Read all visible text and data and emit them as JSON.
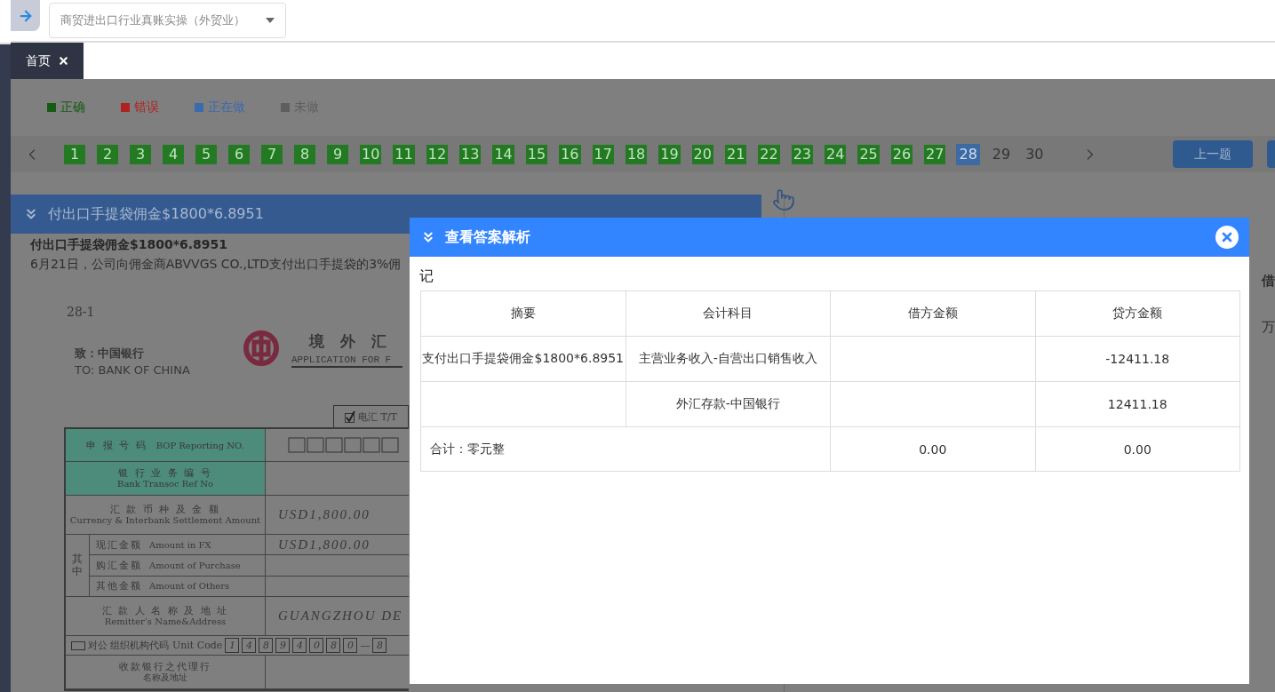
{
  "top_bar": {
    "course_select": {
      "value": "商贸进出口行业真账实操（外贸业）"
    }
  },
  "tabs": [
    {
      "label": "首页",
      "selected": true
    }
  ],
  "legend": [
    {
      "label": "正确",
      "color": "#145c14"
    },
    {
      "label": "错误",
      "color": "#b02222"
    },
    {
      "label": "正在做",
      "color": "#3a6ab0"
    },
    {
      "label": "未做",
      "color": "#5e5e5e"
    }
  ],
  "question_nav": {
    "items": [
      {
        "label": "1",
        "correct": true,
        "selected": false
      },
      {
        "label": "2",
        "correct": true,
        "selected": false
      },
      {
        "label": "3",
        "correct": true,
        "selected": false
      },
      {
        "label": "4",
        "correct": true,
        "selected": false
      },
      {
        "label": "5",
        "correct": true,
        "selected": false
      },
      {
        "label": "6",
        "correct": true,
        "selected": false
      },
      {
        "label": "7",
        "correct": true,
        "selected": false
      },
      {
        "label": "8",
        "correct": true,
        "selected": false
      },
      {
        "label": "9",
        "correct": true,
        "selected": false
      },
      {
        "label": "10",
        "correct": true,
        "selected": false
      },
      {
        "label": "11",
        "correct": true,
        "selected": false
      },
      {
        "label": "12",
        "correct": true,
        "selected": false
      },
      {
        "label": "13",
        "correct": true,
        "selected": false
      },
      {
        "label": "14",
        "correct": true,
        "selected": false
      },
      {
        "label": "15",
        "correct": true,
        "selected": false
      },
      {
        "label": "16",
        "correct": true,
        "selected": false
      },
      {
        "label": "17",
        "correct": true,
        "selected": false
      },
      {
        "label": "18",
        "correct": true,
        "selected": false
      },
      {
        "label": "19",
        "correct": true,
        "selected": false
      },
      {
        "label": "20",
        "correct": true,
        "selected": false
      },
      {
        "label": "21",
        "correct": true,
        "selected": false
      },
      {
        "label": "22",
        "correct": true,
        "selected": false
      },
      {
        "label": "23",
        "correct": true,
        "selected": false
      },
      {
        "label": "24",
        "correct": true,
        "selected": false
      },
      {
        "label": "25",
        "correct": true,
        "selected": false
      },
      {
        "label": "26",
        "correct": true,
        "selected": false
      },
      {
        "label": "27",
        "correct": true,
        "selected": false
      },
      {
        "label": "28",
        "correct": false,
        "selected": true
      },
      {
        "label": "29",
        "correct": false,
        "selected": false
      },
      {
        "label": "30",
        "correct": false,
        "selected": false
      }
    ],
    "prev_button": {
      "label": "上一题"
    }
  },
  "question": {
    "banner": "付出口手提袋佣金$1800*6.8951",
    "heading": "付出口手提袋佣金$1800*6.8951",
    "description": "6月21日，公司向佣金商ABVVGS CO.,LTD支付出口手提袋的3%佣"
  },
  "document": {
    "number": "28-1",
    "to_cn": "致：中国银行",
    "to_en": "TO: BANK OF CHINA",
    "title_cn": "境外汇",
    "title_en": "APPLICATION FOR F",
    "transfer_option": {
      "label": "电汇 T/T",
      "checked": true
    },
    "rows": [
      {
        "kind": "inline",
        "label_cn": "申 报 号 码",
        "label_en": "BOP Reporting NO.",
        "highlight": true
      },
      {
        "kind": "stacked",
        "label_cn": "银 行 业 务 编 号",
        "label_en": "Bank Transoc Ref No",
        "highlight": true
      },
      {
        "kind": "stacked",
        "label_cn": "汇 款 币 种 及 金 额",
        "label_en": "Currency & Interbank Settlement Amount",
        "highlight": false,
        "value": "USD1,800.00"
      },
      {
        "kind": "group",
        "label": "其中",
        "items": [
          {
            "label_cn": "现汇金额",
            "label_en": "Amount in FX",
            "value": "USD1,800.00"
          },
          {
            "label_cn": "购汇金额",
            "label_en": "Amount of Purchase"
          },
          {
            "label_cn": "其他金额",
            "label_en": "Amount of Others"
          }
        ]
      },
      {
        "kind": "stacked",
        "label_cn": "汇 款 人 名 称 及 地 址",
        "label_en": "Remitter’s Name&Address",
        "highlight": false,
        "value": "GUANGZHOU DE"
      },
      {
        "kind": "code",
        "checked": false,
        "label": "对公 组织机构代码 Unit Code",
        "digits": [
          "1",
          "4",
          "8",
          "9",
          "4",
          "0",
          "8",
          "0"
        ],
        "separator": "—",
        "tail": "8"
      },
      {
        "kind": "stacked",
        "label_cn": "收款银行之代理行",
        "label_en": "名称及地址",
        "highlight": false
      }
    ]
  },
  "ledger_fragment": {
    "header": "借",
    "digits": [
      "万"
    ]
  },
  "modal": {
    "title": "查看答案解析",
    "voucher_type": "记",
    "columns": [
      "摘要",
      "会计科目",
      "借方金额",
      "贷方金额"
    ],
    "rows": [
      {
        "summary": "支付出口手提袋佣金$1800*6.8951",
        "account": "主营业务收入-自营出口销售收入",
        "credit": "-12411.18"
      },
      {
        "account": "外汇存款-中国银行",
        "credit": "12411.18"
      }
    ],
    "total": {
      "label": "合计：零元整",
      "debit": "0.00",
      "credit": "0.00"
    }
  }
}
